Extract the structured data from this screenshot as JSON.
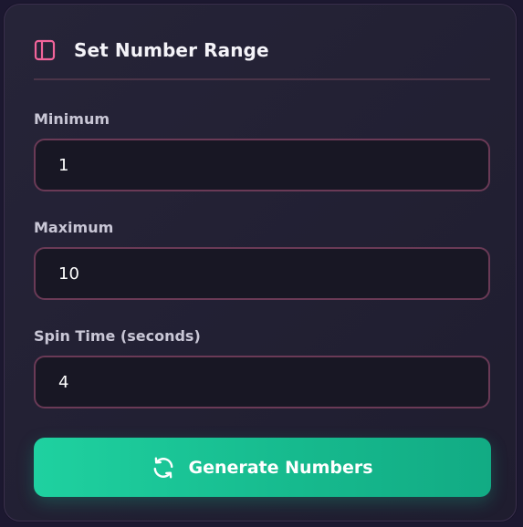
{
  "panel": {
    "title": "Set Number Range",
    "icon": "sidebar-panel-icon",
    "accent_color": "#f2649a"
  },
  "fields": {
    "minimum": {
      "label": "Minimum",
      "value": "1"
    },
    "maximum": {
      "label": "Maximum",
      "value": "10"
    },
    "spin_time": {
      "label": "Spin Time (seconds)",
      "value": "4"
    }
  },
  "generate_button": {
    "label": "Generate Numbers",
    "icon": "refresh-icon",
    "color": "#1cc99a"
  }
}
